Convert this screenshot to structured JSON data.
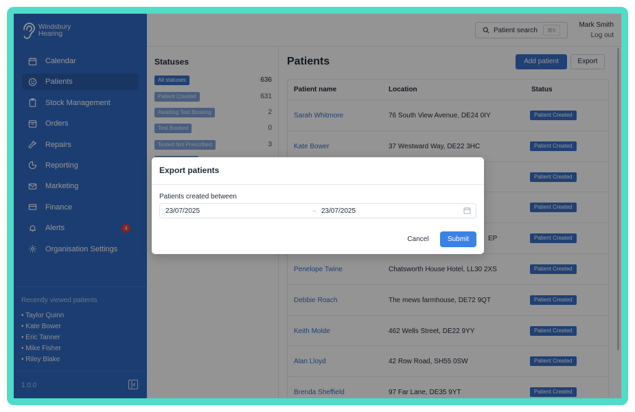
{
  "brand": {
    "name_line1": "Windsbury",
    "name_line2": "Hearing"
  },
  "sidebar": {
    "items": [
      {
        "label": "Calendar",
        "icon": "calendar-icon"
      },
      {
        "label": "Patients",
        "icon": "smile-icon",
        "active": true
      },
      {
        "label": "Stock Management",
        "icon": "clipboard-icon"
      },
      {
        "label": "Orders",
        "icon": "inbox-icon"
      },
      {
        "label": "Repairs",
        "icon": "wrench-icon"
      },
      {
        "label": "Reporting",
        "icon": "pie-chart-icon"
      },
      {
        "label": "Marketing",
        "icon": "mail-icon"
      },
      {
        "label": "Finance",
        "icon": "credit-card-icon"
      },
      {
        "label": "Alerts",
        "icon": "bell-icon",
        "badge": "4"
      },
      {
        "label": "Organisation Settings",
        "icon": "gear-icon"
      }
    ],
    "recent_title": "Recently viewed patients",
    "recent": [
      "• Taylor Quinn",
      "• Kate Bower",
      "• Eric Tanner",
      "• Mike Fisher",
      "• Riley Blake"
    ],
    "version": "1.0.0"
  },
  "topbar": {
    "search_label": "Patient search",
    "search_shortcut": "⌘K",
    "user_name": "Mark Smith",
    "logout": "Log out"
  },
  "statuses": {
    "title": "Statuses",
    "items": [
      {
        "label": "All statuses",
        "count": "636"
      },
      {
        "label": "Patient Created",
        "count": "631"
      },
      {
        "label": "Awaiting Test Booking",
        "count": "2"
      },
      {
        "label": "Test Booked",
        "count": "0"
      },
      {
        "label": "Tested Not Prescribed",
        "count": "3"
      }
    ]
  },
  "patients": {
    "title": "Patients",
    "add_button": "Add patient",
    "export_button": "Export",
    "columns": [
      "Patient name",
      "Location",
      "Status"
    ],
    "rows": [
      {
        "name": "Sarah Whitmore",
        "location": "76 South View Avenue, DE24 0IY",
        "status": "Patient Created"
      },
      {
        "name": "Kate Bower",
        "location": "37 Westward Way, DE22 3HC",
        "status": "Patient Created"
      },
      {
        "name": "",
        "location": "",
        "status": "Patient Created"
      },
      {
        "name": "",
        "location": "",
        "status": "Patient Created"
      },
      {
        "name": "",
        "location": "EP",
        "status": "Patient Created"
      },
      {
        "name": "Penelope Twine",
        "location": "Chatsworth House Hotel, LL30 2XS",
        "status": "Patient Created"
      },
      {
        "name": "Debbie Roach",
        "location": "The mews farmhouse, DE72 9QT",
        "status": "Patient Created"
      },
      {
        "name": "Keith Molde",
        "location": "462 Wells Street, DE22 9YY",
        "status": "Patient Created"
      },
      {
        "name": "Alan Lloyd",
        "location": "42 Row Road, SH55 0SW",
        "status": "Patient Created"
      },
      {
        "name": "Brenda Sheffield",
        "location": "97 Far Lane, DE35 9YT",
        "status": "Patient Created"
      }
    ]
  },
  "export_modal": {
    "title": "Export patients",
    "field_label": "Patients created between",
    "start_date": "23/07/2025",
    "end_date": "23/07/2025",
    "range_arrow": "→",
    "cancel": "Cancel",
    "submit": "Submit"
  }
}
